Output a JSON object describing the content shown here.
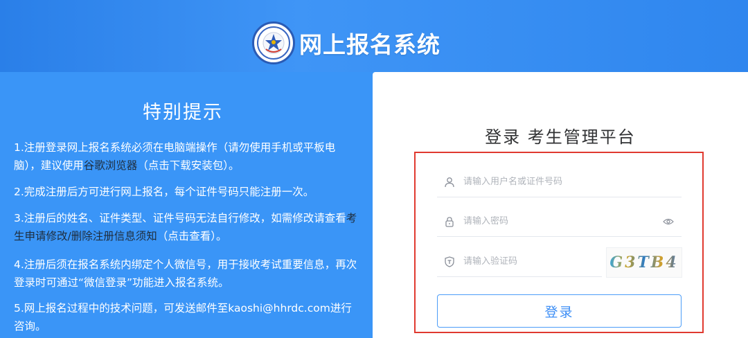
{
  "header": {
    "title": "网上报名系统",
    "logo_icon": "emblem-logo-icon"
  },
  "notice": {
    "title": "特别提示",
    "items": [
      {
        "pre": "1.注册登录网上报名系统必须在电脑端操作（请勿使用手机或平板电脑），建议使用",
        "link": "谷歌浏览器",
        "post": "（点击下载安装包）。"
      },
      {
        "pre": "2.完成注册后方可进行网上报名，每个证件号码只能注册一次。",
        "link": "",
        "post": ""
      },
      {
        "pre": "3.注册后的姓名、证件类型、证件号码无法自行修改，如需修改请查看",
        "link": "考生申请修改/删除注册信息须知",
        "post": "（点击查看）。"
      },
      {
        "pre": "4.注册后须在报名系统内绑定个人微信号，用于接收考试重要信息，再次登录时可通过“微信登录”功能进入报名系统。",
        "link": "",
        "post": ""
      },
      {
        "pre": "5.网上报名过程中的技术问题，可发送邮件至kaoshi@hhrdc.com进行咨询。",
        "link": "",
        "post": ""
      }
    ]
  },
  "login": {
    "title": "登录 考生管理平台",
    "username_placeholder": "请输入用户名或证件号码",
    "password_placeholder": "请输入密码",
    "captcha_placeholder": "请输入验证码",
    "captcha_text": "G3TB4",
    "button_label": "登录",
    "icons": {
      "user": "user-icon",
      "lock": "lock-icon",
      "shield": "shield-icon",
      "eye": "eye-icon"
    }
  },
  "colors": {
    "brand_blue": "#3a95f7",
    "button_text": "#3c8ef5",
    "highlight_red": "#e0392f"
  }
}
